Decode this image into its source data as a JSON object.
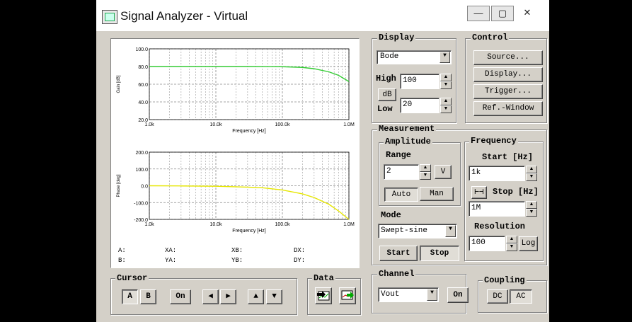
{
  "window": {
    "title": "Signal Analyzer - Virtual"
  },
  "caption_buttons": {
    "minimize": "—",
    "maximize": "▢",
    "close": "✕"
  },
  "plot": {
    "gain": {
      "ylabel": "Gain [dB]",
      "yticks": [
        "100.0",
        "80.0",
        "60.0",
        "40.0",
        "20.0"
      ],
      "xticks": [
        "1.0k",
        "10.0k",
        "100.0k",
        "1.0M"
      ],
      "xlabel": "Frequency [Hz]"
    },
    "phase": {
      "ylabel": "Phase [deg]",
      "yticks": [
        "200.0",
        "100.0",
        "0.0",
        "-100.0",
        "-200.0"
      ],
      "xticks": [
        "1.0k",
        "10.0k",
        "100.0k",
        "1.0M"
      ],
      "xlabel": "Frequency [Hz]"
    },
    "readouts": [
      "A:",
      "XA:",
      "XB:",
      "DX:",
      "B:",
      "YA:",
      "YB:",
      "DY:"
    ]
  },
  "chart_data": [
    {
      "type": "line",
      "title": "",
      "xlabel": "Frequency [Hz]",
      "ylabel": "Gain [dB]",
      "xscale": "log",
      "xlim": [
        1000,
        1000000
      ],
      "ylim": [
        20,
        100
      ],
      "grid": true,
      "series": [
        {
          "color": "#33cc33",
          "x": [
            1000,
            3000,
            10000,
            30000,
            100000,
            200000,
            300000,
            500000,
            700000,
            1000000
          ],
          "y": [
            80,
            80,
            80,
            80,
            79.8,
            79,
            77.5,
            74,
            70,
            63
          ]
        }
      ]
    },
    {
      "type": "line",
      "title": "",
      "xlabel": "Frequency [Hz]",
      "ylabel": "Phase [deg]",
      "xscale": "log",
      "xlim": [
        1000,
        1000000
      ],
      "ylim": [
        -200,
        200
      ],
      "grid": true,
      "series": [
        {
          "color": "#e6e600",
          "x": [
            1000,
            3000,
            10000,
            30000,
            50000,
            100000,
            200000,
            300000,
            500000,
            700000,
            1000000
          ],
          "y": [
            0,
            -1,
            -3,
            -8,
            -12,
            -25,
            -48,
            -70,
            -110,
            -150,
            -200
          ]
        }
      ]
    }
  ],
  "display": {
    "label": "Display",
    "mode": "Bode",
    "high_label": "High",
    "high_value": "100",
    "db_button": "dB",
    "low_label": "Low",
    "low_value": "20"
  },
  "control": {
    "label": "Control",
    "source": "Source...",
    "display": "Display...",
    "trigger": "Trigger...",
    "ref_window": "Ref.-Window"
  },
  "measurement": {
    "label": "Measurement",
    "amplitude": {
      "label": "Amplitude",
      "range_label": "Range",
      "range_value": "2",
      "unit": "V",
      "auto": "Auto",
      "man": "Man"
    },
    "mode_label": "Mode",
    "mode_value": "Swept-sine",
    "start": "Start",
    "stop": "Stop",
    "frequency": {
      "label": "Frequency",
      "start_label": "Start [Hz]",
      "start_value": "1k",
      "stop_label": "Stop [Hz]",
      "stop_value": "1M",
      "resolution_label": "Resolution",
      "resolution_value": "100",
      "log_button": "Log"
    }
  },
  "cursor": {
    "label": "Cursor",
    "a": "A",
    "b": "B",
    "on": "On",
    "left": "◀",
    "right": "▶",
    "up": "▲",
    "down": "▼"
  },
  "data": {
    "label": "Data"
  },
  "channel": {
    "label": "Channel",
    "value": "Vout",
    "on": "On"
  },
  "coupling": {
    "label": "Coupling",
    "dc": "DC",
    "ac": "AC"
  }
}
